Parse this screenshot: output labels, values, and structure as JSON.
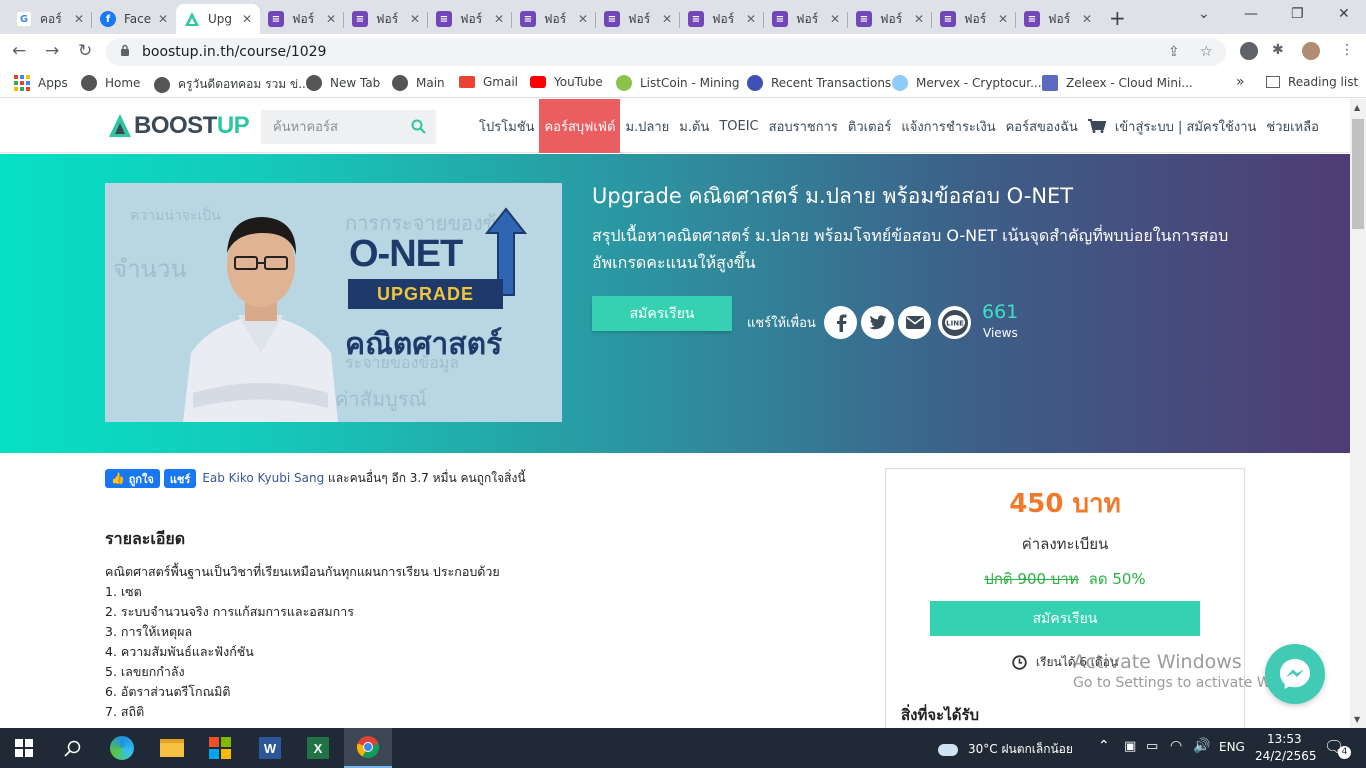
{
  "browser": {
    "tabs": [
      {
        "title": "คอร์",
        "icon": "google-icon"
      },
      {
        "title": "Face",
        "icon": "facebook-icon"
      },
      {
        "title": "Upg",
        "icon": "boostup-icon",
        "active": true
      },
      {
        "title": "ฟอร์",
        "icon": "forms-icon"
      },
      {
        "title": "ฟอร์",
        "icon": "forms-icon"
      },
      {
        "title": "ฟอร์",
        "icon": "forms-icon"
      },
      {
        "title": "ฟอร์",
        "icon": "forms-icon"
      },
      {
        "title": "ฟอร์",
        "icon": "forms-icon"
      },
      {
        "title": "ฟอร์",
        "icon": "forms-icon"
      },
      {
        "title": "ฟอร์",
        "icon": "forms-icon"
      },
      {
        "title": "ฟอร์",
        "icon": "forms-icon"
      },
      {
        "title": "ฟอร์",
        "icon": "forms-icon"
      },
      {
        "title": "ฟอร์",
        "icon": "forms-icon"
      }
    ],
    "url": "boostup.in.th/course/1029",
    "bookmarks": [
      {
        "label": "Apps",
        "icon": "apps-grid-icon"
      },
      {
        "label": "Home",
        "icon": "globe-icon"
      },
      {
        "label": "ครูวันดีดอทคอม รวม ข่...",
        "icon": "globe-icon"
      },
      {
        "label": "New Tab",
        "icon": "globe-icon"
      },
      {
        "label": "Main",
        "icon": "globe-icon"
      },
      {
        "label": "Gmail",
        "icon": "gmail-icon"
      },
      {
        "label": "YouTube",
        "icon": "youtube-icon"
      },
      {
        "label": "ListCoin - Mining",
        "icon": "listcoin-icon"
      },
      {
        "label": "Recent Transactions",
        "icon": "coin-icon"
      },
      {
        "label": "Mervex - Cryptocur...",
        "icon": "mervex-icon"
      },
      {
        "label": "Zeleex - Cloud Mini...",
        "icon": "zeleex-icon"
      }
    ],
    "reading_list": "Reading list"
  },
  "site": {
    "logo_part1": "BOOST",
    "logo_part2": "UP",
    "search_placeholder": "ค้นหาคอร์ส",
    "menu": [
      {
        "label": "โปรโมชัน"
      },
      {
        "label": "คอร์สบุฟเฟ่ต์",
        "active": true
      },
      {
        "label": "ม.ปลาย"
      },
      {
        "label": "ม.ต้น"
      },
      {
        "label": "TOEIC"
      },
      {
        "label": "สอบราชการ"
      },
      {
        "label": "ติวเตอร์"
      },
      {
        "label": "แจ้งการชำระเงิน"
      },
      {
        "label": "คอร์สของฉัน"
      }
    ],
    "login_label": "เข้าสู่ระบบ | สมัครใช้งาน",
    "help_label": "ช่วยเหลือ"
  },
  "hero": {
    "thumbnail": {
      "onet": "O-NET",
      "upgrade": "UPGRADE",
      "subject": "คณิตศาสตร์"
    },
    "title": "Upgrade คณิตศาสตร์ ม.ปลาย พร้อมข้อสอบ O-NET",
    "description": "สรุปเนื้อหาคณิตศาสตร์ ม.ปลาย พร้อมโจทย์ข้อสอบ O-NET เน้นจุดสำคัญที่พบบ่อยในการสอบ อัพเกรดคะแนนให้สูงขึ้น",
    "enroll_label": "สมัครเรียน",
    "share_label": "แชร์ให้เพื่อน",
    "views_count": "661",
    "views_label": "Views"
  },
  "facebook": {
    "like_label": "ถูกใจ",
    "share_label": "แชร์",
    "name": "Eab Kiko Kyubi Sang",
    "text": " และคนอื่นๆ อีก 3.7 หมื่น คนถูกใจสิ่งนี้"
  },
  "details": {
    "title": "รายละเอียด",
    "intro": "คณิตศาสตร์พื้นฐานเป็นวิชาที่เรียนเหมือนกันทุกแผนการเรียน ประกอบด้วย",
    "items": [
      "1. เซต",
      "2. ระบบจำนวนจริง การแก้สมการและอสมการ",
      "3. การให้เหตุผล",
      "4. ความสัมพันธ์และฟังก์ชัน",
      "5. เลขยกกำลัง",
      "6. อัตราส่วนตรีโกณมิติ",
      "7. สถิติ"
    ]
  },
  "pricing": {
    "price": "450 บาท",
    "reg_label": "ค่าลงทะเบียน",
    "original": "ปกติ 900 บาท",
    "discount": "ลด 50%",
    "enroll_label": "สมัครเรียน",
    "duration": "เรียนได้ 6 เดือน",
    "benefits_title": "สิ่งที่จะได้รับ"
  },
  "watermark": {
    "line1": "Activate Windows",
    "line2": "Go to Settings to activate Windows."
  },
  "taskbar": {
    "weather": "30°C  ฝนตกเล็กน้อย",
    "lang": "ENG",
    "time": "13:53",
    "date": "24/2/2565",
    "notifications": "4"
  },
  "colors": {
    "brand_teal": "#2fc7a1",
    "menu_active": "#ea5e62",
    "price_orange": "#f07a2c",
    "discount_green": "#2bb143"
  }
}
